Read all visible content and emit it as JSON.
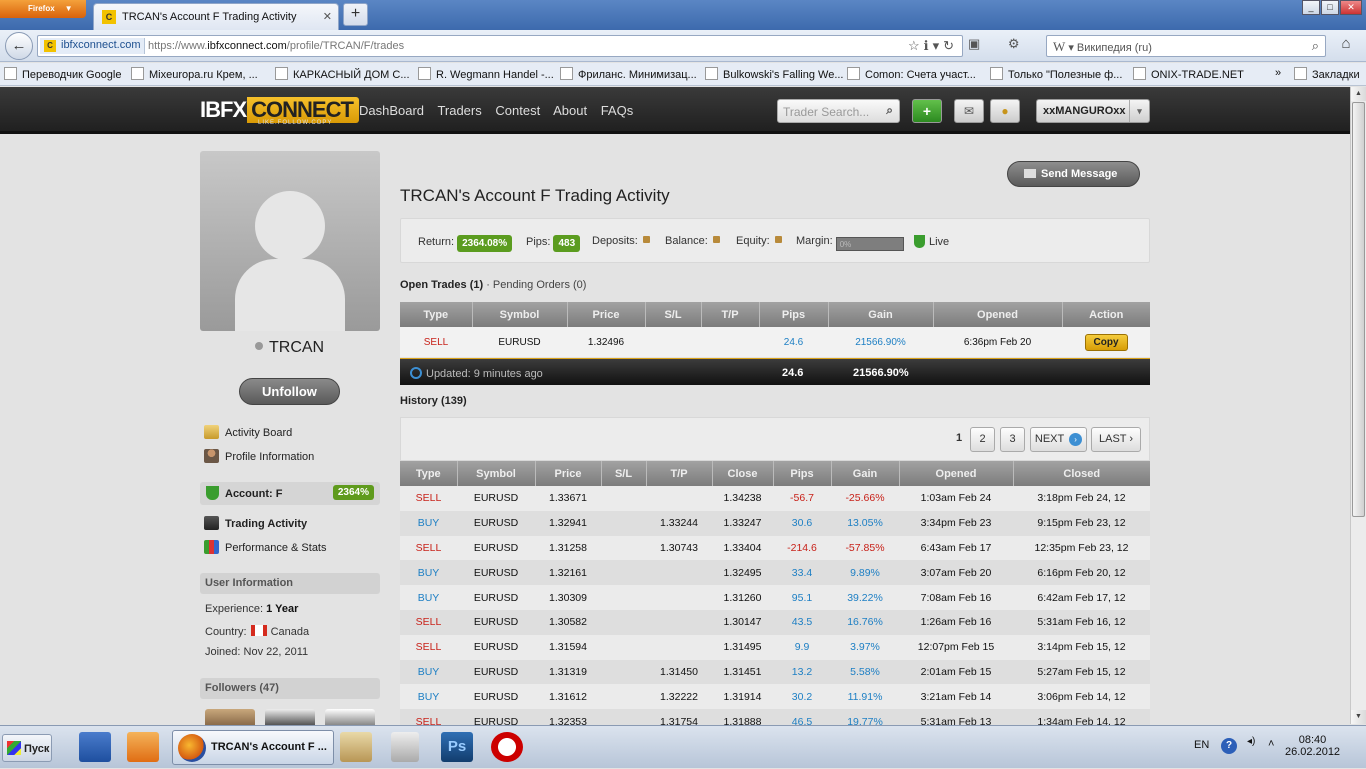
{
  "browser": {
    "app_button": "Firefox",
    "tab_title": "TRCAN's Account F Trading Activity",
    "tab_icon": "C",
    "new_tab": "+",
    "url_site": "ibfxconnect.com",
    "url_prefix": "https://www.",
    "url_domain": "ibfxconnect.com",
    "url_path": "/profile/TRCAN/F/trades",
    "search_engine_label": "Википедия (ru)",
    "window_controls": [
      "_",
      "□",
      "✕"
    ]
  },
  "bookmarks": [
    {
      "label": "Переводчик Google"
    },
    {
      "label": "Mixeuropa.ru Крем, ..."
    },
    {
      "label": "КАРКАСНЫЙ ДОМ С..."
    },
    {
      "label": "R. Wegmann Handel -..."
    },
    {
      "label": "Фриланс. Минимизац..."
    },
    {
      "label": "Bulkowski's Falling We..."
    },
    {
      "label": "Comon: Счета участ..."
    },
    {
      "label": "Только \"Полезные ф..."
    },
    {
      "label": "ONIX-TRADE.NET"
    },
    {
      "label": "»"
    },
    {
      "label": "Закладки"
    }
  ],
  "header": {
    "logo_main": "IBFX",
    "logo_accent": "CONNECT",
    "logo_tagline": "LIKE.FOLLOW.COPY",
    "nav": [
      "DashBoard",
      "Traders",
      "Contest",
      "About",
      "FAQs"
    ],
    "search_placeholder": "Trader Search...",
    "username": "xxMANGUROxx"
  },
  "profile": {
    "name": "TRCAN",
    "unfollow_label": "Unfollow",
    "links": [
      "Activity Board",
      "Profile Information"
    ],
    "account_label": "Account: F",
    "account_pct": "2364%",
    "sub_links": [
      "Trading Activity",
      "Performance & Stats"
    ],
    "user_info_title": "User Information",
    "experience_label": "Experience:",
    "experience_value": "1 Year",
    "country_label": "Country:",
    "country_value": "Canada",
    "joined": "Joined: Nov 22, 2011",
    "followers_title": "Followers (47)"
  },
  "main": {
    "send_message": "Send Message",
    "title": "TRCAN's Account F Trading Activity",
    "stats": {
      "return_label": "Return:",
      "return_value": "2364.08%",
      "pips_label": "Pips:",
      "pips_value": "483",
      "deposits_label": "Deposits:",
      "balance_label": "Balance:",
      "equity_label": "Equity:",
      "margin_label": "Margin:",
      "margin_value": "0%",
      "live_label": "Live"
    },
    "open_trades_title": "Open Trades (1)",
    "pending_orders": "· Pending Orders (0)",
    "open_columns": [
      "Type",
      "Symbol",
      "Price",
      "S/L",
      "T/P",
      "Pips",
      "Gain",
      "Opened",
      "Action"
    ],
    "open_rows": [
      {
        "type": "SELL",
        "symbol": "EURUSD",
        "price": "1.32496",
        "sl": "",
        "tp": "",
        "pips": "24.6",
        "gain": "21566.90%",
        "opened": "6:36pm Feb 20",
        "action": "Copy"
      }
    ],
    "updated": "Updated: 9 minutes ago",
    "total_pips": "24.6",
    "total_gain": "21566.90%",
    "history_title": "History (139)",
    "pages": [
      "1",
      "2",
      "3"
    ],
    "next": "NEXT",
    "last": "LAST ›",
    "history_columns": [
      "Type",
      "Symbol",
      "Price",
      "S/L",
      "T/P",
      "Close",
      "Pips",
      "Gain",
      "Opened",
      "Closed"
    ],
    "history_rows": [
      {
        "type": "SELL",
        "symbol": "EURUSD",
        "price": "1.33671",
        "sl": "",
        "tp": "",
        "close": "1.34238",
        "pips": "-56.7",
        "gain": "-25.66%",
        "opened": "1:03am Feb 24",
        "closed": "3:18pm Feb 24, 12"
      },
      {
        "type": "BUY",
        "symbol": "EURUSD",
        "price": "1.32941",
        "sl": "",
        "tp": "1.33244",
        "close": "1.33247",
        "pips": "30.6",
        "gain": "13.05%",
        "opened": "3:34pm Feb 23",
        "closed": "9:15pm Feb 23, 12"
      },
      {
        "type": "SELL",
        "symbol": "EURUSD",
        "price": "1.31258",
        "sl": "",
        "tp": "1.30743",
        "close": "1.33404",
        "pips": "-214.6",
        "gain": "-57.85%",
        "opened": "6:43am Feb 17",
        "closed": "12:35pm Feb 23, 12"
      },
      {
        "type": "BUY",
        "symbol": "EURUSD",
        "price": "1.32161",
        "sl": "",
        "tp": "",
        "close": "1.32495",
        "pips": "33.4",
        "gain": "9.89%",
        "opened": "3:07am Feb 20",
        "closed": "6:16pm Feb 20, 12"
      },
      {
        "type": "BUY",
        "symbol": "EURUSD",
        "price": "1.30309",
        "sl": "",
        "tp": "",
        "close": "1.31260",
        "pips": "95.1",
        "gain": "39.22%",
        "opened": "7:08am Feb 16",
        "closed": "6:42am Feb 17, 12"
      },
      {
        "type": "SELL",
        "symbol": "EURUSD",
        "price": "1.30582",
        "sl": "",
        "tp": "",
        "close": "1.30147",
        "pips": "43.5",
        "gain": "16.76%",
        "opened": "1:26am Feb 16",
        "closed": "5:31am Feb 16, 12"
      },
      {
        "type": "SELL",
        "symbol": "EURUSD",
        "price": "1.31594",
        "sl": "",
        "tp": "",
        "close": "1.31495",
        "pips": "9.9",
        "gain": "3.97%",
        "opened": "12:07pm Feb 15",
        "closed": "3:14pm Feb 15, 12"
      },
      {
        "type": "BUY",
        "symbol": "EURUSD",
        "price": "1.31319",
        "sl": "",
        "tp": "1.31450",
        "close": "1.31451",
        "pips": "13.2",
        "gain": "5.58%",
        "opened": "2:01am Feb 15",
        "closed": "5:27am Feb 15, 12"
      },
      {
        "type": "BUY",
        "symbol": "EURUSD",
        "price": "1.31612",
        "sl": "",
        "tp": "1.32222",
        "close": "1.31914",
        "pips": "30.2",
        "gain": "11.91%",
        "opened": "3:21am Feb 14",
        "closed": "3:06pm Feb 14, 12"
      },
      {
        "type": "SELL",
        "symbol": "EURUSD",
        "price": "1.32353",
        "sl": "",
        "tp": "1.31754",
        "close": "1.31888",
        "pips": "46.5",
        "gain": "19.77%",
        "opened": "5:31am Feb 13",
        "closed": "1:34am Feb 14, 12"
      }
    ]
  },
  "taskbar": {
    "start": "Пуск",
    "active_task": "TRCAN's Account F ...",
    "lang": "EN",
    "time": "08:40",
    "date": "26.02.2012"
  },
  "colors": {
    "sell": "#c8221a",
    "buy": "#1d7fc4",
    "accent": "#5b9c1f",
    "brand": "#f2b51d"
  }
}
